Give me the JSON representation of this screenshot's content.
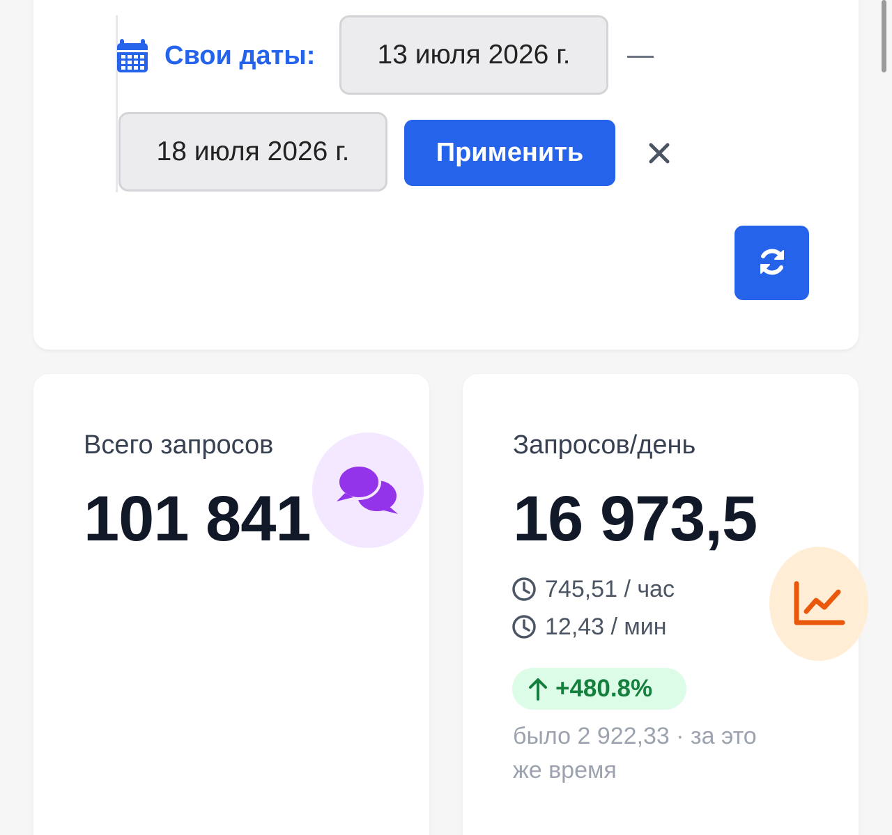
{
  "filter": {
    "custom_range_label": "Свои даты:",
    "date_from": "13 июля 2026 г.",
    "date_to": "18 июля 2026 г.",
    "apply_label": "Применить"
  },
  "cards": {
    "total_requests": {
      "title": "Всего запросов",
      "value": "101 841"
    },
    "requests_per_day": {
      "title": "Запросов/день",
      "value": "16 973,5",
      "per_hour": "745,51 / час",
      "per_minute": "12,43 / мин",
      "change": "+480.8%",
      "previous": "было 2 922,33 · за это же время"
    }
  },
  "colors": {
    "accent": "#2563eb",
    "chat_icon": "#9333ea",
    "chart_icon": "#ea580c",
    "positive": "#15803d"
  },
  "icons": {
    "calendar": "calendar-icon",
    "close": "close-icon",
    "refresh": "refresh-icon",
    "chat": "chat-bubbles-icon",
    "clock": "clock-icon",
    "trend": "line-chart-icon",
    "arrow_up": "arrow-up-icon"
  }
}
